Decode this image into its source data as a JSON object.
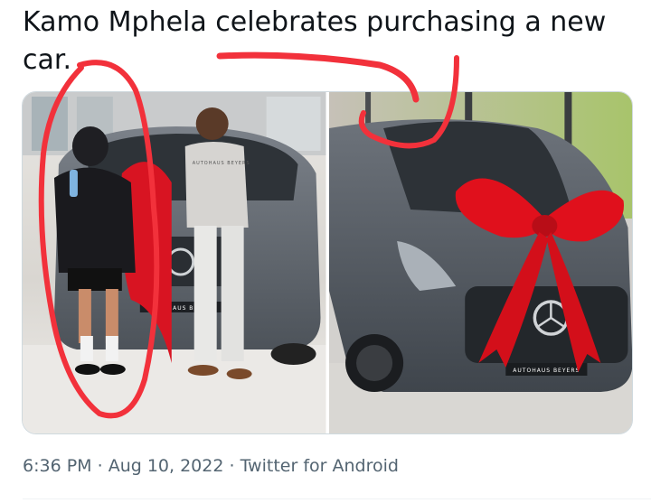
{
  "tweet": {
    "text": "Kamo Mphela celebrates purchasing a new car.",
    "media": [
      {
        "name": "photo-left"
      },
      {
        "name": "photo-right"
      }
    ],
    "image_lettering": {
      "shirt": "AUTOHAUS BEYERS",
      "plate_left": "AUTOHAUS BEYERS",
      "plate_right": "AUTOHAUS BEYERS"
    },
    "timestamp": {
      "time": "6:36 PM",
      "separator": "·",
      "date": "Aug 10, 2022",
      "source": "Twitter for Android"
    }
  },
  "colors": {
    "text": "#0f1419",
    "meta": "#536471",
    "annotation_red": "#f2313b",
    "bow_red": "#e0101c",
    "car_grey": "#5a6068"
  }
}
